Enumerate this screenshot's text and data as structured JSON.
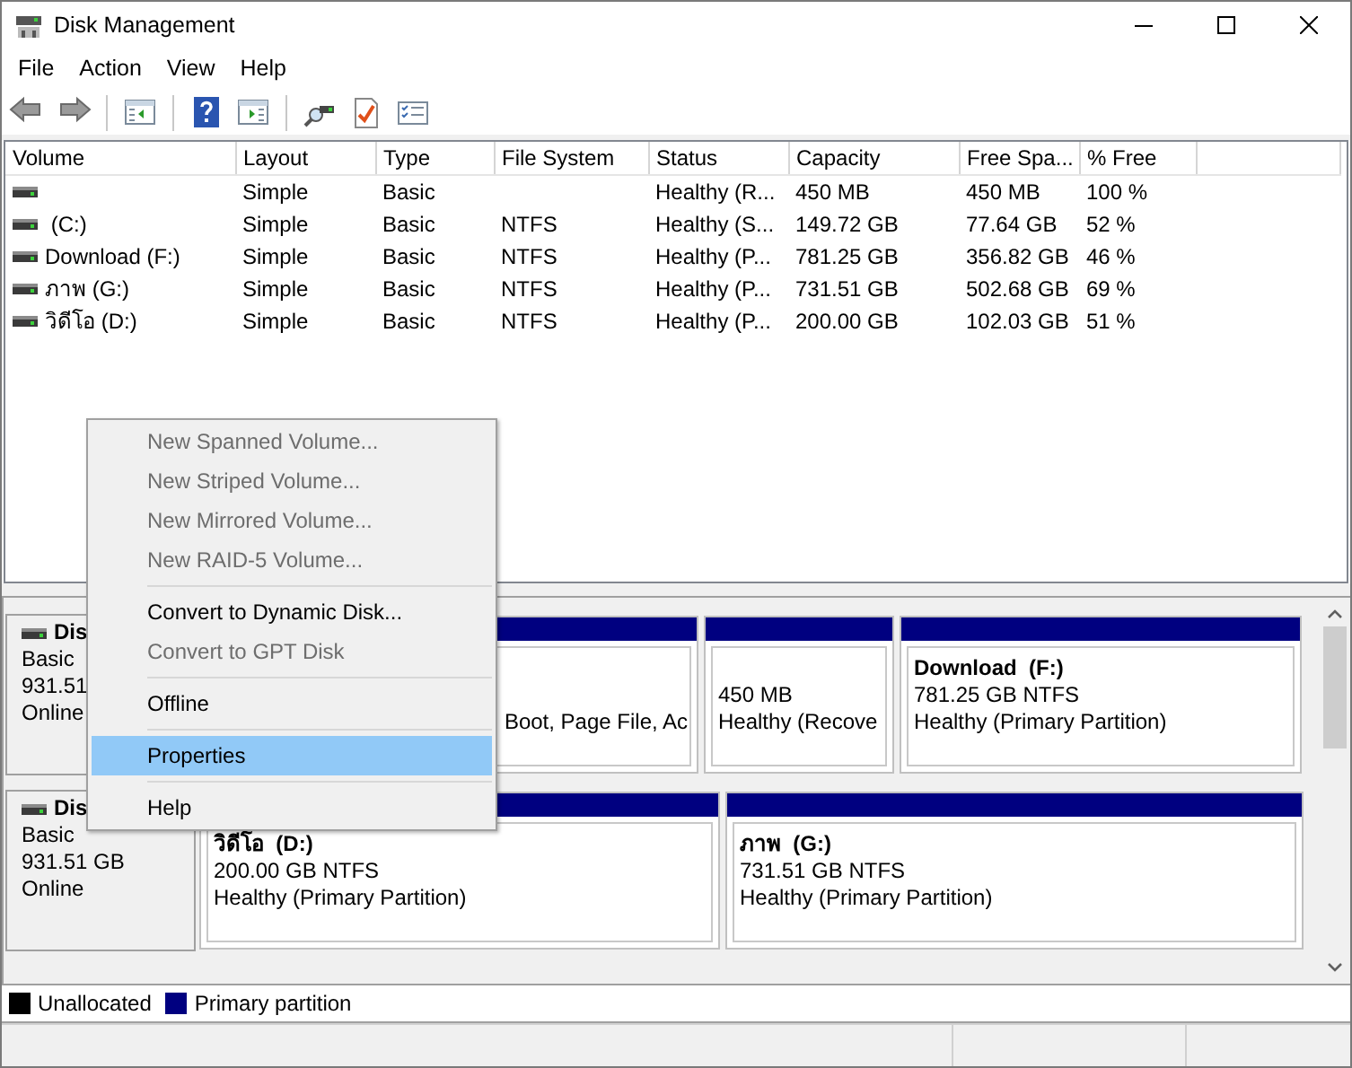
{
  "window": {
    "title": "Disk Management"
  },
  "menu_bar": [
    "File",
    "Action",
    "View",
    "Help"
  ],
  "volume_list": {
    "columns": [
      "Volume",
      "Layout",
      "Type",
      "File System",
      "Status",
      "Capacity",
      "Free Spa...",
      "% Free"
    ],
    "rows": [
      [
        "",
        "Simple",
        "Basic",
        "",
        "Healthy (R...",
        "450 MB",
        "450 MB",
        "100 %"
      ],
      [
        " (C:)",
        "Simple",
        "Basic",
        "NTFS",
        "Healthy (S...",
        "149.72 GB",
        "77.64 GB",
        "52 %"
      ],
      [
        "Download (F:)",
        "Simple",
        "Basic",
        "NTFS",
        "Healthy (P...",
        "781.25 GB",
        "356.82 GB",
        "46 %"
      ],
      [
        "ภาพ (G:)",
        "Simple",
        "Basic",
        "NTFS",
        "Healthy (P...",
        "731.51 GB",
        "502.68 GB",
        "69 %"
      ],
      [
        "วิดีโอ (D:)",
        "Simple",
        "Basic",
        "NTFS",
        "Healthy (P...",
        "200.00 GB",
        "102.03 GB",
        "51 %"
      ]
    ]
  },
  "disks": [
    {
      "name": "Dis",
      "type": "Basic",
      "size": "931.51",
      "status": "Online",
      "partitions": [
        {
          "kind": "primary",
          "status": "Boot, Page File, Ac"
        },
        {
          "kind": "primary",
          "size": "450 MB",
          "status": "Healthy (Recove"
        },
        {
          "kind": "primary",
          "title": "Download  (F:)",
          "size": "781.25 GB NTFS",
          "status": "Healthy (Primary Partition)"
        }
      ]
    },
    {
      "name": "Dis",
      "type": "Basic",
      "size": "931.51 GB",
      "status": "Online",
      "partitions": [
        {
          "kind": "primary",
          "title": "วิดีโอ  (D:)",
          "size": "200.00 GB NTFS",
          "status": "Healthy (Primary Partition)"
        },
        {
          "kind": "primary",
          "title": "ภาพ  (G:)",
          "size": "731.51 GB NTFS",
          "status": "Healthy (Primary Partition)"
        }
      ]
    }
  ],
  "legend": [
    {
      "label": "Unallocated",
      "color": "#000000"
    },
    {
      "label": "Primary partition",
      "color": "#000080"
    }
  ],
  "context_menu": [
    {
      "kind": "item",
      "label": "New Spanned Volume...",
      "disabled": true,
      "selected": false
    },
    {
      "kind": "item",
      "label": "New Striped Volume...",
      "disabled": true,
      "selected": false
    },
    {
      "kind": "item",
      "label": "New Mirrored Volume...",
      "disabled": true,
      "selected": false
    },
    {
      "kind": "item",
      "label": "New RAID-5 Volume...",
      "disabled": true,
      "selected": false
    },
    {
      "kind": "separator"
    },
    {
      "kind": "item",
      "label": "Convert to Dynamic Disk...",
      "disabled": false,
      "selected": false
    },
    {
      "kind": "item",
      "label": "Convert to GPT Disk",
      "disabled": true,
      "selected": false
    },
    {
      "kind": "separator"
    },
    {
      "kind": "item",
      "label": "Offline",
      "disabled": false,
      "selected": false
    },
    {
      "kind": "separator"
    },
    {
      "kind": "item",
      "label": "Properties",
      "disabled": false,
      "selected": true
    },
    {
      "kind": "separator"
    },
    {
      "kind": "item",
      "label": "Help",
      "disabled": false,
      "selected": false
    }
  ]
}
